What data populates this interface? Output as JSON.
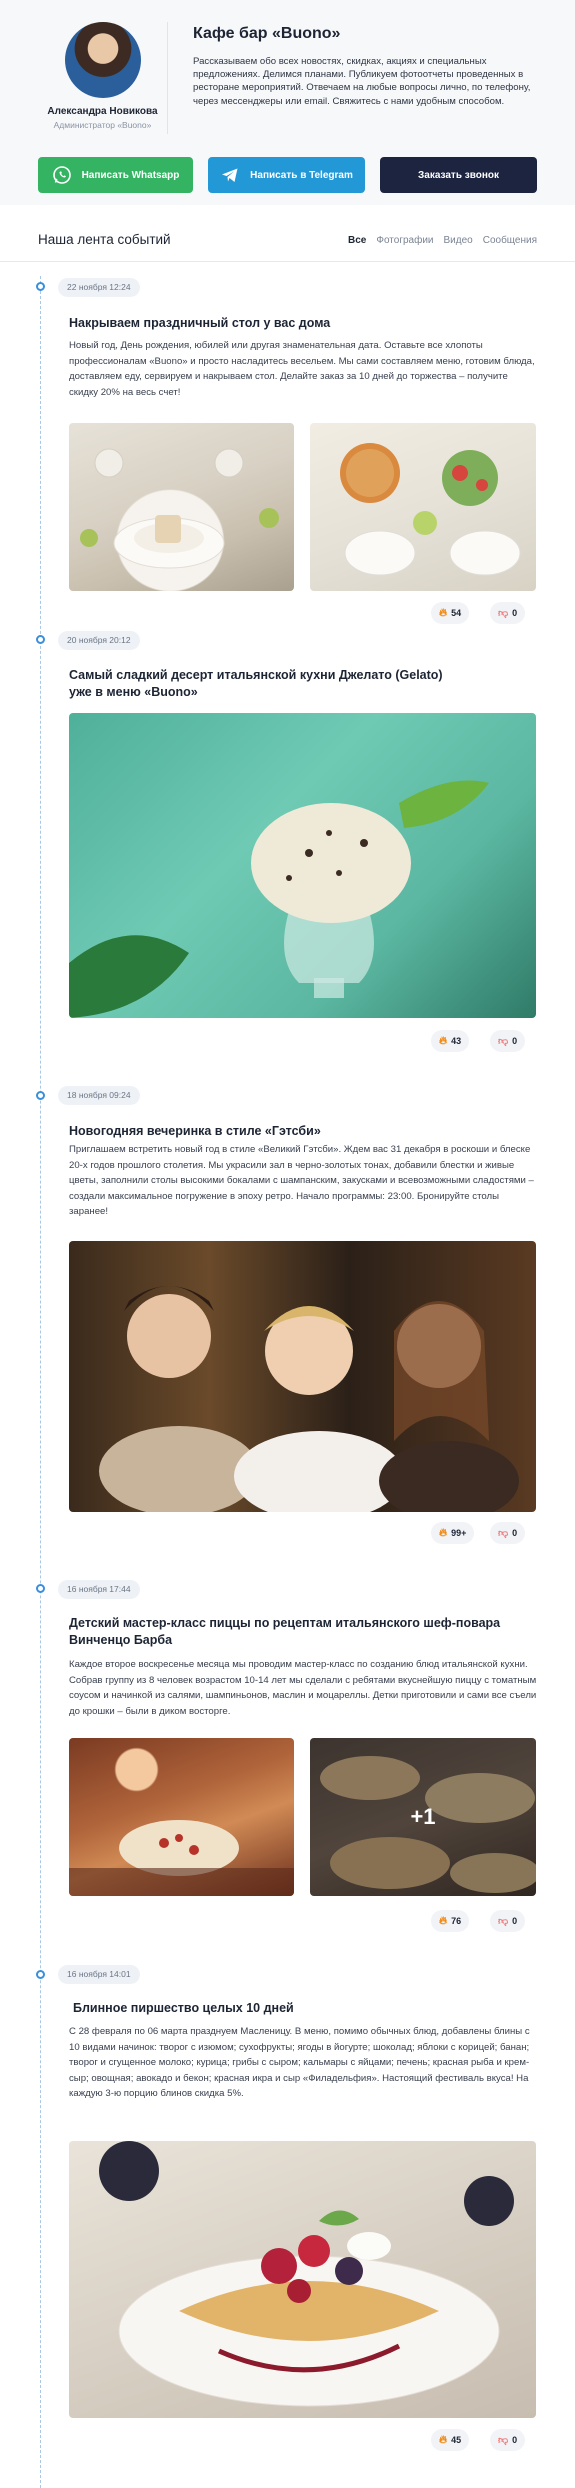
{
  "profile": {
    "name": "Александра Новикова",
    "role": "Администратор «Buono»"
  },
  "company": {
    "title": "Кафе бар «Buono»",
    "description": "Рассказываем обо всех новостях, скидках, акциях и специальных предложениях. Делимся планами. Публикуем фотоотчеты проведенных в ресторане мероприятий. Отвечаем на любые вопросы лично, по телефону, через мессенджеры или email. Свяжитесь с нами удобным способом."
  },
  "buttons": {
    "whatsapp": "Написать Whatsapp",
    "telegram": "Написать в Telegram",
    "call": "Заказать звонок"
  },
  "feed": {
    "title": "Наша лента событий",
    "tabs": [
      "Все",
      "Фотографии",
      "Видео",
      "Сообщения"
    ],
    "active_tab": "Все"
  },
  "posts": [
    {
      "date": "22 ноября 12:24",
      "title": "Накрываем праздничный стол у вас дома",
      "text": "Новый год, День рождения, юбилей или другая знаменательная дата. Оставьте все хлопоты профессионалам «Buono» и просто насладитесь весельем. Мы сами составляем меню, готовим блюда, доставляем еду, сервируем и накрываем стол. Делайте заказ за 10 дней до торжества – получите скидку 20% на весь счет!",
      "likes": "54",
      "dislikes": "0"
    },
    {
      "date": "20 ноября 20:12",
      "title": "Самый сладкий десерт итальянской кухни Джелато (Gelato) уже в меню «Buono»",
      "text": "",
      "likes": "43",
      "dislikes": "0"
    },
    {
      "date": "18 ноября 09:24",
      "title": "Новогодняя вечеринка в стиле «Гэтсби»",
      "text": "Приглашаем встретить новый год в стиле «Великий Гэтсби». Ждем вас 31 декабря в роскоши и блеске 20-х годов прошлого столетия. Мы украсили зал в черно-золотых тонах, добавили блестки и живые цветы, заполнили столы высокими бокалами с шампанским, закусками и всевозможными сладостями – создали максимальное погружение в эпоху ретро. Начало программы: 23:00. Бронируйте столы заранее!",
      "likes": "99+",
      "dislikes": "0"
    },
    {
      "date": "16 ноября 17:44",
      "title": "Детский мастер-класс пиццы по рецептам итальянского шеф-повара Винченцо Барба",
      "text": "Каждое второе воскресенье месяца мы проводим мастер-класс по созданию блюд итальянской кухни. Собрав группу из 8 человек возрастом 10-14 лет мы сделали с ребятами вкуснейшую пиццу с томатным соусом и начинкой из салями, шампиньонов, маслин и моцареллы. Детки приготовили и сами все съели до крошки – были в диком восторге.",
      "more_photos": "+1",
      "likes": "76",
      "dislikes": "0"
    },
    {
      "date": "16 ноября 14:01",
      "title": "Блинное пиршество целых 10 дней",
      "text": "С 28 февраля по 06 марта празднуем Масленицу. В меню, помимо обычных блюд, добавлены блины с 10 видами начинок: творог с изюмом; сухофрукты; ягоды в йогурте; шоколад; яблоки с корицей; банан; творог и сгущенное молоко; курица; грибы с сыром; кальмары с яйцами; печень; красная рыба и крем-сыр; овощная; авокадо и бекон; красная икра и сыр «Филадельфия». Настоящий фестиваль вкуса! На каждую 3-ю порцию блинов скидка 5%.",
      "likes": "45",
      "dislikes": "0"
    }
  ],
  "colors": {
    "whatsapp": "#34b363",
    "telegram": "#2398d6",
    "call": "#1d2440",
    "timeline": "#3a8fdc"
  }
}
